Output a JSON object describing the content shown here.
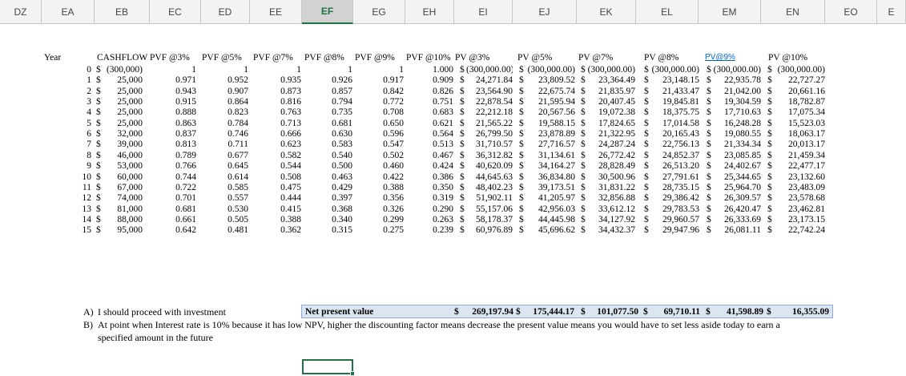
{
  "columns": [
    "DZ",
    "EA",
    "EB",
    "EC",
    "ED",
    "EE",
    "EF",
    "EG",
    "EH",
    "EI",
    "EJ",
    "EK",
    "EL",
    "EM",
    "EN",
    "EO",
    "E"
  ],
  "selected_column": "EF",
  "headers": {
    "year": "Year",
    "cashflow": "CASHFLOW",
    "pvf3": "PVF @3%",
    "pvf5": "PVF @5%",
    "pvf7": "PVF @7%",
    "pvf8": "PVF @8%",
    "pvf9": "PVF @9%",
    "pvf10": "PVF @10%",
    "pv3": "PV @3%",
    "pv5": "PV @5%",
    "pv7": "PV @7%",
    "pv8": "PV @8%",
    "pv9": "PV@9%",
    "pv10": "PV @10%"
  },
  "rows": [
    {
      "year": "0",
      "cf": "(300,000)",
      "f3": "1",
      "f5": "1",
      "f7": "1",
      "f8": "1",
      "f9": "1",
      "f10": "1.000",
      "p3": "(300,000.00)",
      "p5": "(300,000.00)",
      "p7": "(300,000.00)",
      "p8": "(300,000.00)",
      "p9": "(300,000.00)",
      "p10": "(300,000.00)"
    },
    {
      "year": "1",
      "cf": "25,000",
      "f3": "0.971",
      "f5": "0.952",
      "f7": "0.935",
      "f8": "0.926",
      "f9": "0.917",
      "f10": "0.909",
      "p3": "24,271.84",
      "p5": "23,809.52",
      "p7": "23,364.49",
      "p8": "23,148.15",
      "p9": "22,935.78",
      "p10": "22,727.27"
    },
    {
      "year": "2",
      "cf": "25,000",
      "f3": "0.943",
      "f5": "0.907",
      "f7": "0.873",
      "f8": "0.857",
      "f9": "0.842",
      "f10": "0.826",
      "p3": "23,564.90",
      "p5": "22,675.74",
      "p7": "21,835.97",
      "p8": "21,433.47",
      "p9": "21,042.00",
      "p10": "20,661.16"
    },
    {
      "year": "3",
      "cf": "25,000",
      "f3": "0.915",
      "f5": "0.864",
      "f7": "0.816",
      "f8": "0.794",
      "f9": "0.772",
      "f10": "0.751",
      "p3": "22,878.54",
      "p5": "21,595.94",
      "p7": "20,407.45",
      "p8": "19,845.81",
      "p9": "19,304.59",
      "p10": "18,782.87"
    },
    {
      "year": "4",
      "cf": "25,000",
      "f3": "0.888",
      "f5": "0.823",
      "f7": "0.763",
      "f8": "0.735",
      "f9": "0.708",
      "f10": "0.683",
      "p3": "22,212.18",
      "p5": "20,567.56",
      "p7": "19,072.38",
      "p8": "18,375.75",
      "p9": "17,710.63",
      "p10": "17,075.34"
    },
    {
      "year": "5",
      "cf": "25,000",
      "f3": "0.863",
      "f5": "0.784",
      "f7": "0.713",
      "f8": "0.681",
      "f9": "0.650",
      "f10": "0.621",
      "p3": "21,565.22",
      "p5": "19,588.15",
      "p7": "17,824.65",
      "p8": "17,014.58",
      "p9": "16,248.28",
      "p10": "15,523.03"
    },
    {
      "year": "6",
      "cf": "32,000",
      "f3": "0.837",
      "f5": "0.746",
      "f7": "0.666",
      "f8": "0.630",
      "f9": "0.596",
      "f10": "0.564",
      "p3": "26,799.50",
      "p5": "23,878.89",
      "p7": "21,322.95",
      "p8": "20,165.43",
      "p9": "19,080.55",
      "p10": "18,063.17"
    },
    {
      "year": "7",
      "cf": "39,000",
      "f3": "0.813",
      "f5": "0.711",
      "f7": "0.623",
      "f8": "0.583",
      "f9": "0.547",
      "f10": "0.513",
      "p3": "31,710.57",
      "p5": "27,716.57",
      "p7": "24,287.24",
      "p8": "22,756.13",
      "p9": "21,334.34",
      "p10": "20,013.17"
    },
    {
      "year": "8",
      "cf": "46,000",
      "f3": "0.789",
      "f5": "0.677",
      "f7": "0.582",
      "f8": "0.540",
      "f9": "0.502",
      "f10": "0.467",
      "p3": "36,312.82",
      "p5": "31,134.61",
      "p7": "26,772.42",
      "p8": "24,852.37",
      "p9": "23,085.85",
      "p10": "21,459.34"
    },
    {
      "year": "9",
      "cf": "53,000",
      "f3": "0.766",
      "f5": "0.645",
      "f7": "0.544",
      "f8": "0.500",
      "f9": "0.460",
      "f10": "0.424",
      "p3": "40,620.09",
      "p5": "34,164.27",
      "p7": "28,828.49",
      "p8": "26,513.20",
      "p9": "24,402.67",
      "p10": "22,477.17"
    },
    {
      "year": "10",
      "cf": "60,000",
      "f3": "0.744",
      "f5": "0.614",
      "f7": "0.508",
      "f8": "0.463",
      "f9": "0.422",
      "f10": "0.386",
      "p3": "44,645.63",
      "p5": "36,834.80",
      "p7": "30,500.96",
      "p8": "27,791.61",
      "p9": "25,344.65",
      "p10": "23,132.60"
    },
    {
      "year": "11",
      "cf": "67,000",
      "f3": "0.722",
      "f5": "0.585",
      "f7": "0.475",
      "f8": "0.429",
      "f9": "0.388",
      "f10": "0.350",
      "p3": "48,402.23",
      "p5": "39,173.51",
      "p7": "31,831.22",
      "p8": "28,735.15",
      "p9": "25,964.70",
      "p10": "23,483.09"
    },
    {
      "year": "12",
      "cf": "74,000",
      "f3": "0.701",
      "f5": "0.557",
      "f7": "0.444",
      "f8": "0.397",
      "f9": "0.356",
      "f10": "0.319",
      "p3": "51,902.11",
      "p5": "41,205.97",
      "p7": "32,856.88",
      "p8": "29,386.42",
      "p9": "26,309.57",
      "p10": "23,578.68"
    },
    {
      "year": "13",
      "cf": "81,000",
      "f3": "0.681",
      "f5": "0.530",
      "f7": "0.415",
      "f8": "0.368",
      "f9": "0.326",
      "f10": "0.290",
      "p3": "55,157.06",
      "p5": "42,956.03",
      "p7": "33,612.12",
      "p8": "29,783.53",
      "p9": "26,420.47",
      "p10": "23,462.81"
    },
    {
      "year": "14",
      "cf": "88,000",
      "f3": "0.661",
      "f5": "0.505",
      "f7": "0.388",
      "f8": "0.340",
      "f9": "0.299",
      "f10": "0.263",
      "p3": "58,178.37",
      "p5": "44,445.98",
      "p7": "34,127.92",
      "p8": "29,960.57",
      "p9": "26,333.69",
      "p10": "23,173.15"
    },
    {
      "year": "15",
      "cf": "95,000",
      "f3": "0.642",
      "f5": "0.481",
      "f7": "0.362",
      "f8": "0.315",
      "f9": "0.275",
      "f10": "0.239",
      "p3": "60,976.89",
      "p5": "45,696.62",
      "p7": "34,432.37",
      "p8": "29,947.96",
      "p9": "26,081.11",
      "p10": "22,742.24"
    }
  ],
  "currency_symbol": "$",
  "npv": {
    "label": "Net present value",
    "v3": "269,197.94",
    "v5": "175,444.17",
    "v7": "101,077.50",
    "v8": "69,710.11",
    "v9": "41,598.89",
    "v10": "16,355.09"
  },
  "answers": {
    "a_marker": "A)",
    "a_text": "I should proceed with investment",
    "b_marker": "B)",
    "b_line1": "At point when Interest rate is 10% because it has low NPV, higher the discounting factor means decrease the present value means you would have to set less aside today to earn a",
    "b_line2": "specified amount in the future"
  },
  "colors": {
    "selected_header_text": "#217346",
    "npv_fill": "#dce6f1",
    "link": "#0563c1"
  }
}
